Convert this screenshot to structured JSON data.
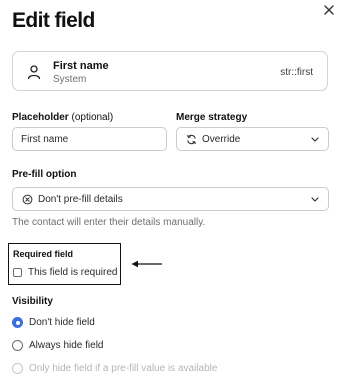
{
  "dialog": {
    "title": "Edit field"
  },
  "field": {
    "name": "First name",
    "source": "System",
    "key": "str::first"
  },
  "placeholder": {
    "label": "Placeholder",
    "label_suffix": "(optional)",
    "value": "First name"
  },
  "merge": {
    "label": "Merge strategy",
    "value": "Override"
  },
  "prefill": {
    "label": "Pre-fill option",
    "value": "Don't pre-fill details",
    "hint": "The contact will enter their details manually."
  },
  "required": {
    "title": "Required field",
    "checkbox_label": "This field is required",
    "checked": false
  },
  "visibility": {
    "label": "Visibility",
    "options": [
      {
        "label": "Don't hide field",
        "selected": true,
        "disabled": false
      },
      {
        "label": "Always hide field",
        "selected": false,
        "disabled": false
      },
      {
        "label": "Only hide field if a pre-fill value is available",
        "selected": false,
        "disabled": true
      }
    ]
  },
  "icons": {
    "close": "close-icon",
    "user": "user-icon",
    "sync": "sync-icon",
    "no_prefill": "circle-x-icon",
    "chevron": "chevron-down-icon",
    "annotation_arrow": "arrow-left-icon"
  },
  "colors": {
    "accent": "#3e6ddc",
    "text": "#111111",
    "muted": "#6b6e74",
    "border": "#c9ccd1"
  }
}
